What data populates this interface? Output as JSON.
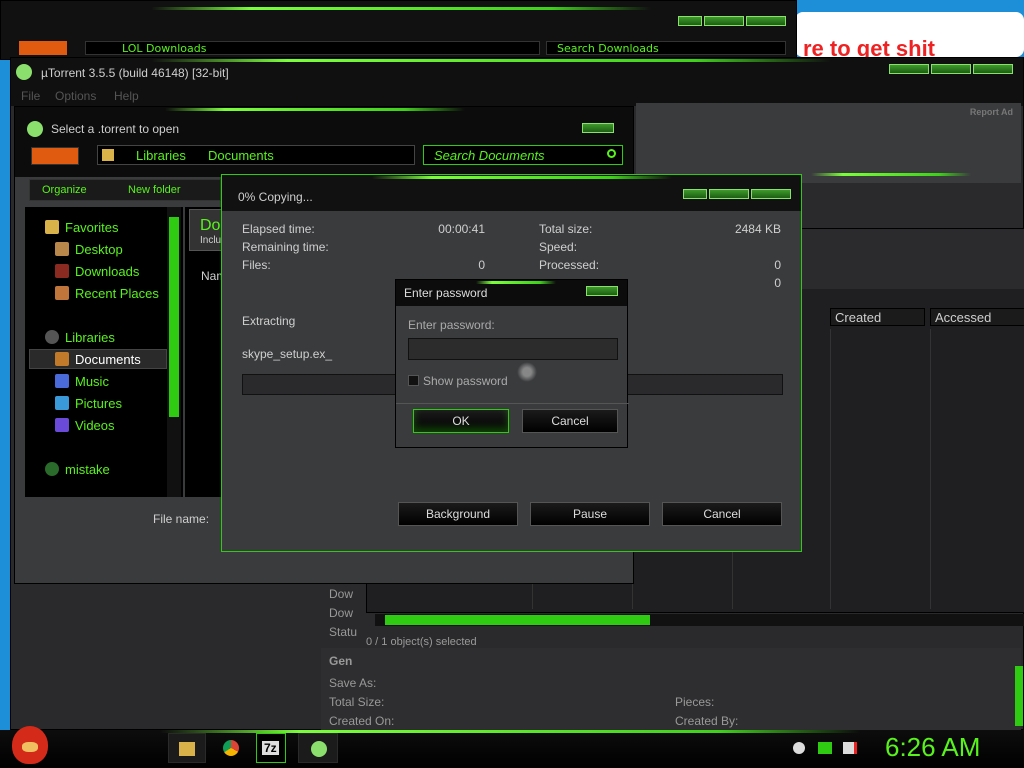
{
  "desktop": {
    "banner_text": "re to get shit"
  },
  "explorer_back": {
    "address": "LOL  Downloads",
    "search_placeholder": "Search Downloads"
  },
  "utorrent": {
    "title": "µTorrent 3.5.5  (build 46148) [32-bit]",
    "menu": [
      "File",
      "Options",
      "Help"
    ],
    "report_ad": "Report Ad",
    "columns": [
      "Created",
      "Accessed"
    ],
    "status": "0 / 1 object(s) selected",
    "side_rows": [
      "Dow",
      "Dow",
      "Statu",
      "Gen"
    ],
    "general": {
      "save_as": "Save As:",
      "total_size": "Total Size:",
      "created_on": "Created On:",
      "pieces": "Pieces:",
      "created_by": "Created By:"
    }
  },
  "open_dialog": {
    "title": "Select a .torrent to open",
    "breadcrumb": [
      "Libraries",
      "Documents"
    ],
    "search_placeholder": "Search Documents",
    "organize": "Organize",
    "new_folder": "New folder",
    "nav": {
      "favorites": "Favorites",
      "desktop": "Desktop",
      "downloads": "Downloads",
      "recent": "Recent Places",
      "libraries": "Libraries",
      "documents": "Documents",
      "music": "Music",
      "pictures": "Pictures",
      "videos": "Videos",
      "mistake": "mistake"
    },
    "header_big": "Do",
    "header_sub": "Inclu",
    "col_name": "Nam",
    "file_name_label": "File name:"
  },
  "copy_dialog": {
    "title": "0% Copying...",
    "elapsed_label": "Elapsed time:",
    "elapsed_value": "00:00:41",
    "remaining_label": "Remaining time:",
    "files_label": "Files:",
    "files_value": "0",
    "total_size_label": "Total size:",
    "total_size_value": "2484 KB",
    "speed_label": "Speed:",
    "processed_label": "Processed:",
    "processed_value": "0",
    "extra_value": "0",
    "extracting": "Extracting",
    "filename": "skype_setup.ex_",
    "progress": 0,
    "buttons": {
      "background": "Background",
      "pause": "Pause",
      "cancel": "Cancel"
    }
  },
  "password_dialog": {
    "title": "Enter password",
    "prompt": "Enter password:",
    "value": "",
    "show_password": "Show password",
    "show_password_checked": false,
    "ok": "OK",
    "cancel": "Cancel"
  },
  "taskbar": {
    "clock": "6:26 AM",
    "apps": [
      "explorer-icon",
      "chrome-icon",
      "7zip-icon",
      "utorrent-icon"
    ],
    "seven_zip": "7z"
  },
  "colors": {
    "accent": "#58f21c",
    "desktop": "#1c8fd8",
    "window": "#3a3b3d"
  }
}
